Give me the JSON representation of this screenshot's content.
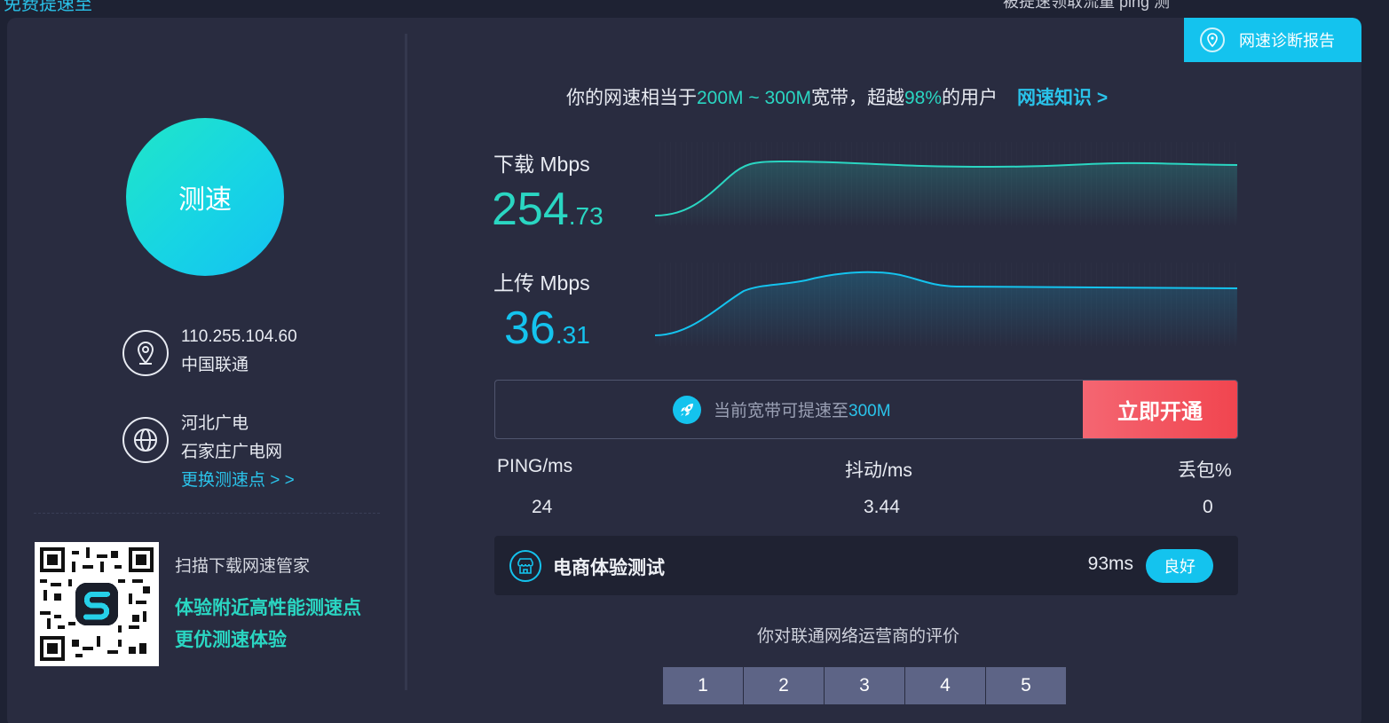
{
  "top": {
    "left_cut": "免费提速至",
    "right_cut": "被提速领取流量 ping 测"
  },
  "diag_button": {
    "label": "网速诊断报告",
    "icon": "location-bulb-icon"
  },
  "speed_button": {
    "label": "测速"
  },
  "location": {
    "ip": "110.255.104.60",
    "isp": "中国联通",
    "icon": "location-pin-icon"
  },
  "server": {
    "province": "河北广电",
    "node": "石家庄广电网",
    "change_link": "更换测速点 > >",
    "icon": "globe-icon"
  },
  "qr": {
    "caption": "扫描下载网速管家",
    "line1": "体验附近高性能测速点",
    "line2": "更优测速体验"
  },
  "headline": {
    "prefix": "你的网速相当于",
    "range": "200M ~ 300M",
    "mid": "宽带，超越",
    "percent": "98%",
    "suffix": "的用户",
    "link": "网速知识 >"
  },
  "download": {
    "label": "下载 Mbps",
    "int": "254",
    "dec": ".73"
  },
  "upload": {
    "label": "上传 Mbps",
    "int": "36",
    "dec": ".31"
  },
  "promo": {
    "text": "当前宽带可提速至",
    "highlight": "300M",
    "button": "立即开通"
  },
  "stats": {
    "ping_label": "PING/ms",
    "ping": "24",
    "jitter_label": "抖动/ms",
    "jitter": "3.44",
    "loss_label": "丢包%",
    "loss": "0"
  },
  "ecom": {
    "title": "电商体验测试",
    "ms": "93ms",
    "badge": "良好"
  },
  "rating": {
    "question": "你对联通网络运营商的评价",
    "options": [
      "1",
      "2",
      "3",
      "4",
      "5"
    ]
  },
  "colors": {
    "bg": "#1e2233",
    "card": "#292c40",
    "cyan": "#14c3ee",
    "green": "#2ad6c2",
    "red": "#f1454f"
  }
}
